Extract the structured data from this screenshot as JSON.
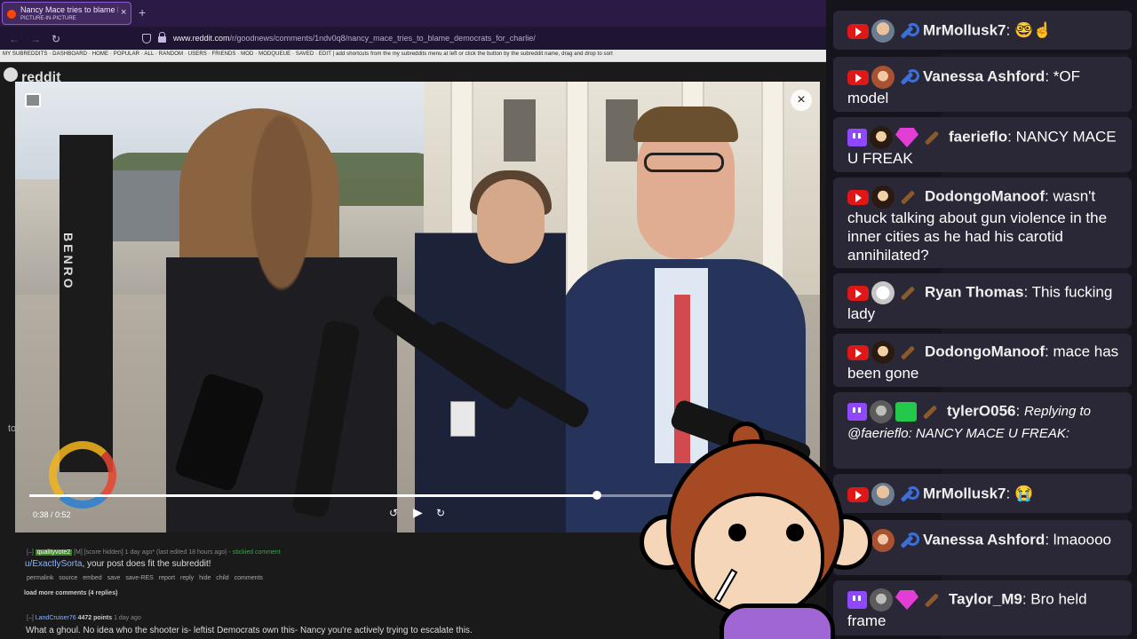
{
  "browser": {
    "tab_title": "Nancy Mace tries to blame Dem",
    "tab_subtitle": "PICTURE-IN-PICTURE",
    "url_domain": "www.reddit.com",
    "url_path": "/r/goodnews/comments/1ndv0q8/nancy_mace_tries_to_blame_democrats_for_charlie/"
  },
  "reddit": {
    "topbar": "MY SUBREDDITS · DASHBOARD · HOME · POPULAR · ALL · RANDOM · USERS · FRIENDS · MOD · MODQUEUE · SAVED · EDIT  |  add shortcuts from the my subreddits menu at left or click the button by the subreddit name, drag and drop to sort",
    "logo": "reddit"
  },
  "video": {
    "strap_text": "BENRO",
    "time": "0:38 / 0:52",
    "progress": 0.73
  },
  "comments": {
    "c1_user": "qualityvote2",
    "c1_meta": "[M] [score hidden] 1 day ago* (last edited 18 hours ago) -",
    "c1_sticky": "stickied comment",
    "c1_body_user": "u/ExactlySorta",
    "c1_body": ", your post does fit the subreddit!",
    "c1_actions": "permalink source embed save save-RES report reply hide child comments",
    "load_more": "load more comments (4 replies)",
    "c2_user": "LandCruiser76",
    "c2_points": "4472 points",
    "c2_time": "1 day ago",
    "c2_body": "What a ghoul. No idea who the shooter is- leftist Democrats own this- Nancy you're actively trying to escalate this.",
    "side_text": "to"
  },
  "chat": [
    {
      "name": "MrMollusk7",
      "text": "🤓☝️"
    },
    {
      "name": "Vanessa Ashford",
      "text": "*OF model"
    },
    {
      "name": "faerieflo",
      "text": "NANCY MACE U FREAK"
    },
    {
      "name": "DodongoManoof",
      "text": "wasn't chuck talking about gun violence in the inner cities as he had his carotid annihilated?"
    },
    {
      "name": "Ryan Thomas",
      "text": "This fucking lady"
    },
    {
      "name": "DodongoManoof",
      "text": "mace has been gone"
    },
    {
      "name": "tylerO056",
      "text": "Replying to @faerieflo: NANCY MACE U FREAK:"
    },
    {
      "name": "MrMollusk7",
      "text": "😭"
    },
    {
      "name": "Vanessa Ashford",
      "text": "lmaoooo"
    },
    {
      "name": "Taylor_M9",
      "text": "Bro held frame"
    }
  ]
}
